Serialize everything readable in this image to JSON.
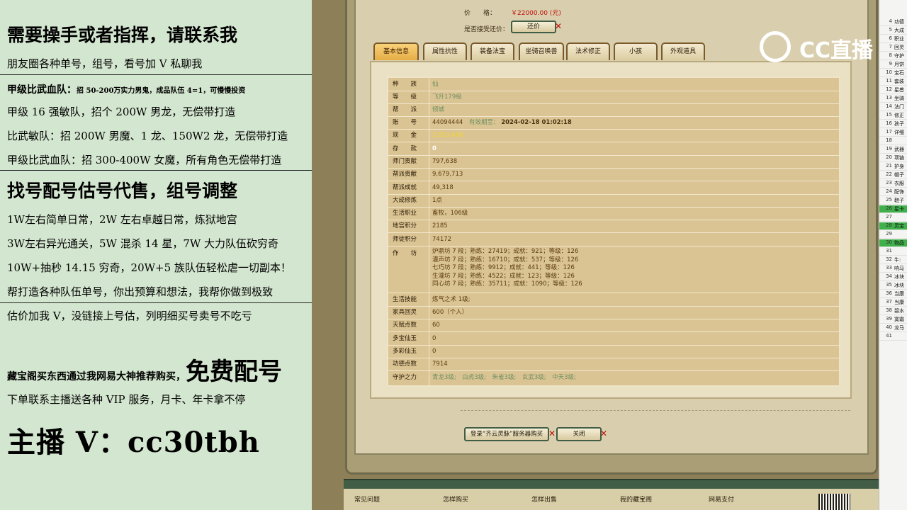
{
  "left_panel": {
    "heading": "需要操手或者指挥，请联系我",
    "line_1": "朋友圈各种单号，组号，看号加 V 私聊我",
    "line_2a": "甲级比武血队：",
    "line_2b": "招 50-200万实力男鬼，成品队伍 4=1，可慢慢投资",
    "line_3": "甲级 16 强敏队，招个 200W 男龙，无偿带打造",
    "line_4": "比武敏队：招 200W 男魔、1 龙、150W2 龙，无偿带打造",
    "line_5": "甲级比武血队：招 300-400W 女魔，所有角色无偿带打造",
    "heading_2": "找号配号估号代售，组号调整",
    "line_6": "1W左右简单日常，2W 左右卓越日常，炼狱地宫",
    "line_7": "3W左右异光通关，5W 混杀 14 星，7W 大力队伍砍穷奇",
    "line_8": "10W+抽秒 14.15 穷奇，20W+5 族队伍轻松虐一切副本！",
    "line_9": "帮打造各种队伍单号，你出预算和想法，我帮你做到极致",
    "line_10": "估价加我 V，没链接上号估，列明细买号卖号不吃亏",
    "line_11a": "藏宝阁买东西通过我网易大神推荐购买，",
    "line_11b": "免费配号",
    "line_12": "下单联系主播送各种 VIP 服务，月卡、年卡拿不停",
    "host": "主播 V：cc30tbh"
  },
  "game": {
    "price_label": "价　　格：",
    "price_value": "￥22000.00 (元)",
    "counter_offer_label": "是否接受还价：",
    "counter_offer_button": "还价",
    "tabs": [
      "基本信息",
      "属性抗性",
      "装备法宝",
      "坐骑召唤兽",
      "法术修正",
      "小孩",
      "外观道具"
    ],
    "rows": [
      {
        "label": "种　　族",
        "value": "仙"
      },
      {
        "label": "等　　级",
        "value": "飞升179级"
      },
      {
        "label": "帮　　派",
        "value": "倾城"
      },
      {
        "label": "账　　号",
        "value": "44094444",
        "extra_label": "有效期至：",
        "extra_value": "2024-02-18 01:02:18"
      },
      {
        "label": "现　　金",
        "value": "2,053,486"
      },
      {
        "label": "存　　款",
        "value": "0"
      },
      {
        "label": "师门贡献",
        "value": "797,638"
      },
      {
        "label": "帮派贡献",
        "value": "9,679,713"
      },
      {
        "label": "帮派成就",
        "value": "49,318"
      },
      {
        "label": "大成修炼",
        "value": "1点"
      },
      {
        "label": "生活职业",
        "value": "畜牧，106级"
      },
      {
        "label": "地宫积分",
        "value": "2185"
      },
      {
        "label": "师徒积分",
        "value": "74172"
      }
    ],
    "workshop_label": "作　　坊",
    "workshop_lines": [
      "炉鼎坊 7 段；熟练：27419；成就：921；等级：126",
      "灌声坊 7 段；熟练：16710；成就：537；等级：126",
      "七巧坊 7 段；熟练：9912；成就：441；等级：126",
      "生灌坊 7 段；熟练：4522；成就：123；等级：126",
      "同心坊 7 段；熟练：35711；成就：1090；等级：126"
    ],
    "rows_2": [
      {
        "label": "生活技能",
        "value": "炼气之术 1级;"
      },
      {
        "label": "家具回灵",
        "value": "600（个人）"
      },
      {
        "label": "天赋点数",
        "value": "60"
      },
      {
        "label": "多宝仙玉",
        "value": "0"
      },
      {
        "label": "多彩仙玉",
        "value": "0"
      },
      {
        "label": "功德点数",
        "value": "7914"
      },
      {
        "label": "守护之力",
        "value": "青龙3级;　白虎3级;　朱雀3级;　玄武3级;　中天3级;"
      }
    ],
    "login_button": "登录“齐云灵脉”服务器购买",
    "close_button": "关闭",
    "footer_links": [
      "常见问题",
      "怎样购买",
      "怎样出售",
      "我的藏宝阁",
      "网易支付"
    ],
    "watermark": "CC直播"
  },
  "sheet": {
    "rows": [
      {
        "n": "4",
        "t": "功德"
      },
      {
        "n": "5",
        "t": "大成"
      },
      {
        "n": "6",
        "t": "职业"
      },
      {
        "n": "7",
        "t": "回灵"
      },
      {
        "n": "8",
        "t": "守护"
      },
      {
        "n": "9",
        "t": "月饼"
      },
      {
        "n": "10",
        "t": "宝石"
      },
      {
        "n": "11",
        "t": "套装"
      },
      {
        "n": "12",
        "t": "星叁"
      },
      {
        "n": "13",
        "t": "坐骑"
      },
      {
        "n": "14",
        "t": "法门"
      },
      {
        "n": "15",
        "t": "修正"
      },
      {
        "n": "16",
        "t": "孩子"
      },
      {
        "n": "17",
        "t": "详细"
      },
      {
        "n": "18",
        "t": ""
      },
      {
        "n": "19",
        "t": "武器"
      },
      {
        "n": "20",
        "t": "项链"
      },
      {
        "n": "21",
        "t": "护身"
      },
      {
        "n": "22",
        "t": "帽子"
      },
      {
        "n": "23",
        "t": "衣服"
      },
      {
        "n": "24",
        "t": "配饰"
      },
      {
        "n": "25",
        "t": "鞋子"
      },
      {
        "n": "26",
        "t": "星卡"
      },
      {
        "n": "27",
        "t": ""
      },
      {
        "n": "28",
        "t": "灵宝"
      },
      {
        "n": "29",
        "t": ""
      },
      {
        "n": "30",
        "t": "物品"
      },
      {
        "n": "31",
        "t": ""
      },
      {
        "n": "32",
        "t": "牛:"
      },
      {
        "n": "33",
        "t": "响马"
      },
      {
        "n": "34",
        "t": "冰块"
      },
      {
        "n": "35",
        "t": "冰块"
      },
      {
        "n": "36",
        "t": "当康"
      },
      {
        "n": "37",
        "t": "当康"
      },
      {
        "n": "38",
        "t": "碧水"
      },
      {
        "n": "39",
        "t": "寞霜"
      },
      {
        "n": "40",
        "t": "龙马"
      },
      {
        "n": "41",
        "t": ""
      }
    ]
  }
}
